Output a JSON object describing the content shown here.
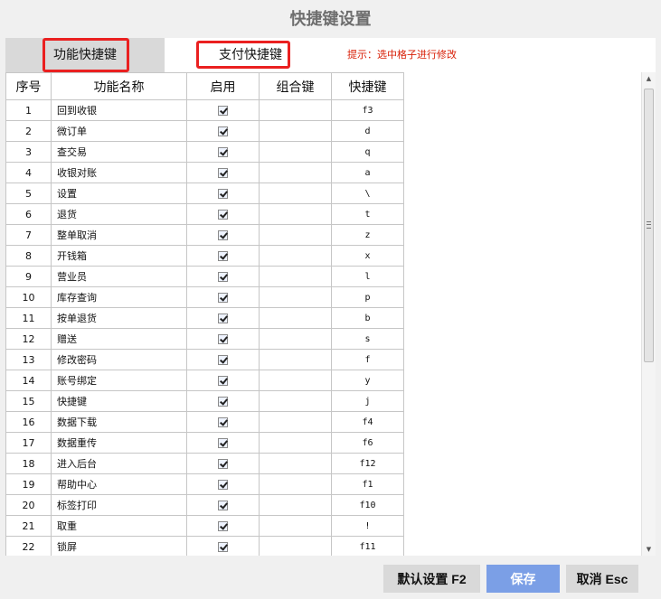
{
  "window": {
    "title": "快捷键设置"
  },
  "tabs": [
    {
      "label": "功能快捷键",
      "active": true
    },
    {
      "label": "支付快捷键",
      "active": false
    }
  ],
  "hint": "提示：选中格子进行修改",
  "table": {
    "headers": [
      "序号",
      "功能名称",
      "启用",
      "组合键",
      "快捷键"
    ],
    "rows": [
      {
        "seq": "1",
        "name": "回到收银",
        "enabled": true,
        "combo": "",
        "key": "f3"
      },
      {
        "seq": "2",
        "name": "微订单",
        "enabled": true,
        "combo": "",
        "key": "d"
      },
      {
        "seq": "3",
        "name": "查交易",
        "enabled": true,
        "combo": "",
        "key": "q"
      },
      {
        "seq": "4",
        "name": "收银对账",
        "enabled": true,
        "combo": "",
        "key": "a"
      },
      {
        "seq": "5",
        "name": "设置",
        "enabled": true,
        "combo": "",
        "key": "\\"
      },
      {
        "seq": "6",
        "name": "退货",
        "enabled": true,
        "combo": "",
        "key": "t"
      },
      {
        "seq": "7",
        "name": "整单取消",
        "enabled": true,
        "combo": "",
        "key": "z"
      },
      {
        "seq": "8",
        "name": "开钱箱",
        "enabled": true,
        "combo": "",
        "key": "x"
      },
      {
        "seq": "9",
        "name": "营业员",
        "enabled": true,
        "combo": "",
        "key": "l"
      },
      {
        "seq": "10",
        "name": "库存查询",
        "enabled": true,
        "combo": "",
        "key": "p"
      },
      {
        "seq": "11",
        "name": "按单退货",
        "enabled": true,
        "combo": "",
        "key": "b"
      },
      {
        "seq": "12",
        "name": "赠送",
        "enabled": true,
        "combo": "",
        "key": "s"
      },
      {
        "seq": "13",
        "name": "修改密码",
        "enabled": true,
        "combo": "",
        "key": "f"
      },
      {
        "seq": "14",
        "name": "账号绑定",
        "enabled": true,
        "combo": "",
        "key": "y"
      },
      {
        "seq": "15",
        "name": "快捷键",
        "enabled": true,
        "combo": "",
        "key": "j"
      },
      {
        "seq": "16",
        "name": "数据下载",
        "enabled": true,
        "combo": "",
        "key": "f4"
      },
      {
        "seq": "17",
        "name": "数据重传",
        "enabled": true,
        "combo": "",
        "key": "f6"
      },
      {
        "seq": "18",
        "name": "进入后台",
        "enabled": true,
        "combo": "",
        "key": "f12"
      },
      {
        "seq": "19",
        "name": "帮助中心",
        "enabled": true,
        "combo": "",
        "key": "f1"
      },
      {
        "seq": "20",
        "name": "标签打印",
        "enabled": true,
        "combo": "",
        "key": "f10"
      },
      {
        "seq": "21",
        "name": "取重",
        "enabled": true,
        "combo": "",
        "key": "!"
      },
      {
        "seq": "22",
        "name": "锁屏",
        "enabled": true,
        "combo": "",
        "key": "f11"
      }
    ]
  },
  "buttons": {
    "default": "默认设置 F2",
    "save": "保存",
    "cancel": "取消 Esc"
  },
  "colors": {
    "highlight": "#ea2020",
    "hint": "#d81e06",
    "save_button": "#7b9fe6",
    "active_tab": "#d9d9d9"
  }
}
